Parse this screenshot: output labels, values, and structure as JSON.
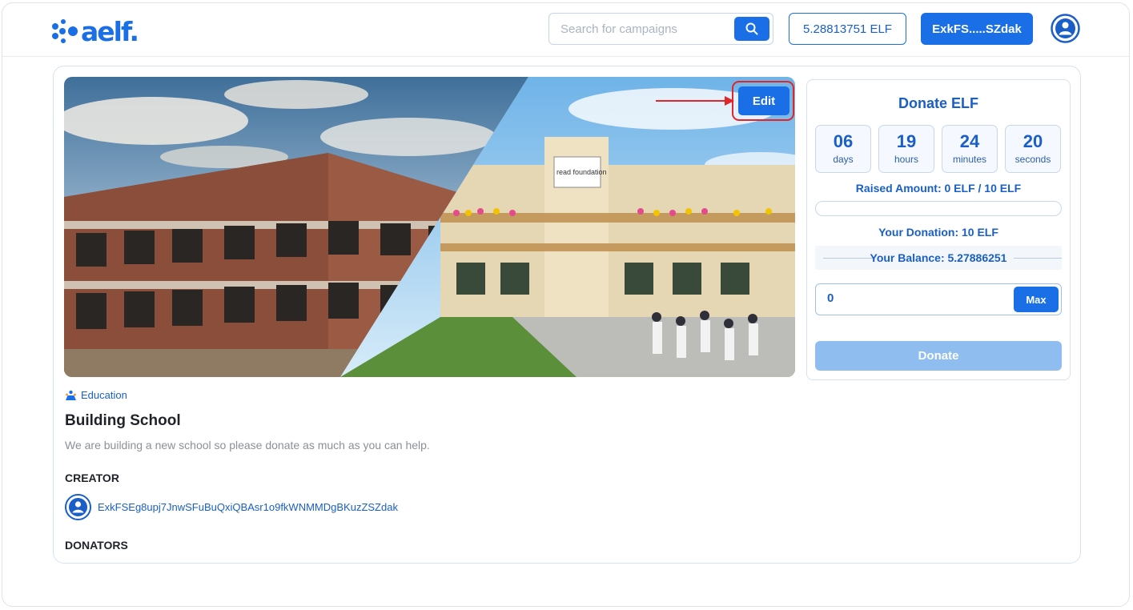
{
  "header": {
    "logo_text": "aelf.",
    "search_placeholder": "Search for campaigns",
    "balance": "5.28813751 ELF",
    "wallet": "ExkFS.....SZdak"
  },
  "campaign": {
    "edit_label": "Edit",
    "category": "Education",
    "title": "Building School",
    "description": "We are building a new school so please donate as much as you can help.",
    "creator_label": "CREATOR",
    "creator_address": "ExkFSEg8upj7JnwSFuBuQxiQBAsr1o9fkWNMMDgBKuzZSZdak",
    "donators_label": "DONATORS",
    "image_sign_text": "read foundation"
  },
  "donate": {
    "title": "Donate ELF",
    "countdown": [
      {
        "value": "06",
        "unit": "days"
      },
      {
        "value": "19",
        "unit": "hours"
      },
      {
        "value": "24",
        "unit": "minutes"
      },
      {
        "value": "20",
        "unit": "seconds"
      }
    ],
    "raised": "Raised Amount: 0 ELF / 10 ELF",
    "raised_fraction": 0,
    "your_donation": "Your Donation: 10 ELF",
    "your_balance": "Your Balance: 5.27886251",
    "amount_value": "0",
    "max_label": "Max",
    "donate_label": "Donate"
  },
  "colors": {
    "accent": "#1a6fe6",
    "highlight": "#e0262b",
    "disabled_button": "#8fbdf0"
  }
}
